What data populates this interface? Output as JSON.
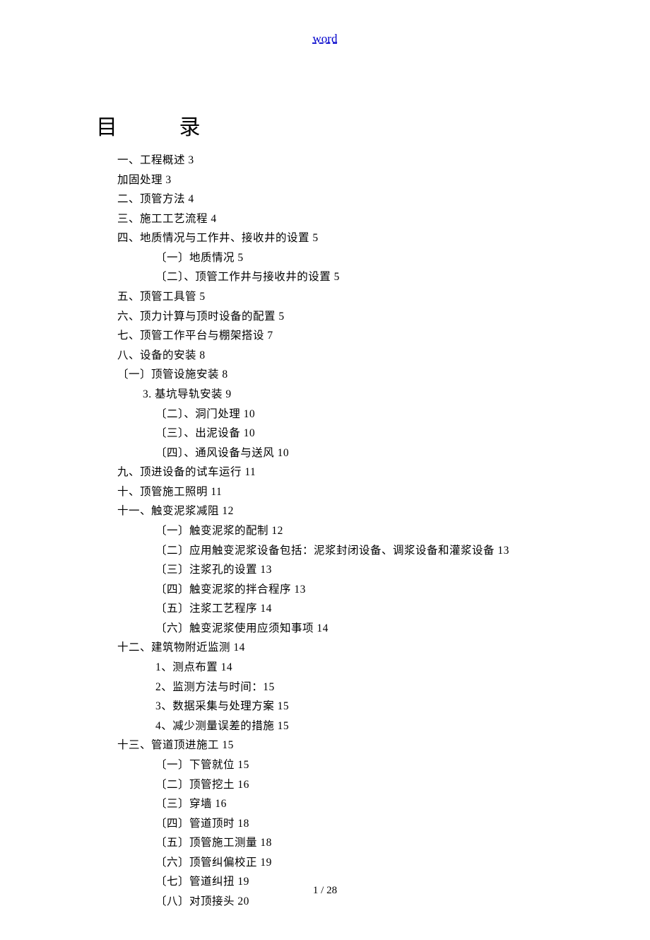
{
  "header": {
    "link_text": "word"
  },
  "toc": {
    "title": "目  录",
    "lines": [
      {
        "cls": "indent-1",
        "text": "一、工程概述 3"
      },
      {
        "cls": "indent-1",
        "text": "加固处理 3"
      },
      {
        "cls": "indent-1",
        "text": "二、顶管方法 4"
      },
      {
        "cls": "indent-1",
        "text": "三、施工工艺流程 4"
      },
      {
        "cls": "indent-1",
        "text": "四、地质情况与工作井、接收井的设置 5"
      },
      {
        "cls": "indent-3",
        "text": "〔一〕地质情况 5"
      },
      {
        "cls": "indent-3",
        "text": "〔二〕、顶管工作井与接收井的设置 5"
      },
      {
        "cls": "indent-1",
        "text": "五、顶管工具管 5"
      },
      {
        "cls": "indent-1",
        "text": "六、顶力计算与顶时设备的配置 5"
      },
      {
        "cls": "indent-1",
        "text": "七、顶管工作平台与棚架搭设 7"
      },
      {
        "cls": "indent-1",
        "text": "八、设备的安装 8"
      },
      {
        "cls": "indent-1",
        "text": "〔一〕顶管设施安装 8"
      },
      {
        "cls": "indent-2",
        "text": "3. 基坑导轨安装 9"
      },
      {
        "cls": "indent-3",
        "text": "〔二〕、洞门处理 10"
      },
      {
        "cls": "indent-3",
        "text": "〔三〕、出泥设备 10"
      },
      {
        "cls": "indent-3",
        "text": "〔四〕、通风设备与送风 10"
      },
      {
        "cls": "indent-1",
        "text": "九、顶进设备的试车运行 11"
      },
      {
        "cls": "indent-1",
        "text": "十、顶管施工照明 11"
      },
      {
        "cls": "indent-1",
        "text": "十一、触变泥浆减阻 12"
      },
      {
        "cls": "indent-3b",
        "text": "〔一〕触变泥浆的配制 12"
      },
      {
        "cls": "indent-3b",
        "text": "〔二〕应用触变泥浆设备包括：泥浆封闭设备、调浆设备和灌浆设备 13"
      },
      {
        "cls": "indent-3b",
        "text": "〔三〕注浆孔的设置 13"
      },
      {
        "cls": "indent-3b",
        "text": "〔四〕触变泥浆的拌合程序 13"
      },
      {
        "cls": "indent-3b",
        "text": "〔五〕注浆工艺程序 14"
      },
      {
        "cls": "indent-3b",
        "text": "〔六〕触变泥浆使用应须知事项 14"
      },
      {
        "cls": "indent-1",
        "text": "十二、建筑物附近监测 14"
      },
      {
        "cls": "indent-3b",
        "text": "1、测点布置 14"
      },
      {
        "cls": "indent-3b",
        "text": "2、监测方法与时间：15"
      },
      {
        "cls": "indent-3b",
        "text": "3、数据采集与处理方案 15"
      },
      {
        "cls": "indent-3b",
        "text": "4、减少测量误差的措施 15"
      },
      {
        "cls": "indent-1",
        "text": "十三、管道顶进施工 15"
      },
      {
        "cls": "indent-3b",
        "text": "〔一〕下管就位 15"
      },
      {
        "cls": "indent-3b",
        "text": "〔二〕顶管挖土 16"
      },
      {
        "cls": "indent-3b",
        "text": "〔三〕穿墙 16"
      },
      {
        "cls": "indent-3b",
        "text": "〔四〕管道顶时 18"
      },
      {
        "cls": "indent-3b",
        "text": "〔五〕顶管施工测量 18"
      },
      {
        "cls": "indent-3b",
        "text": "〔六〕顶管纠偏校正 19"
      },
      {
        "cls": "indent-3b",
        "text": "〔七〕管道纠扭 19"
      },
      {
        "cls": "indent-3b",
        "text": "〔八〕对顶接头 20"
      }
    ]
  },
  "footer": {
    "page_indicator": "1 / 28"
  }
}
